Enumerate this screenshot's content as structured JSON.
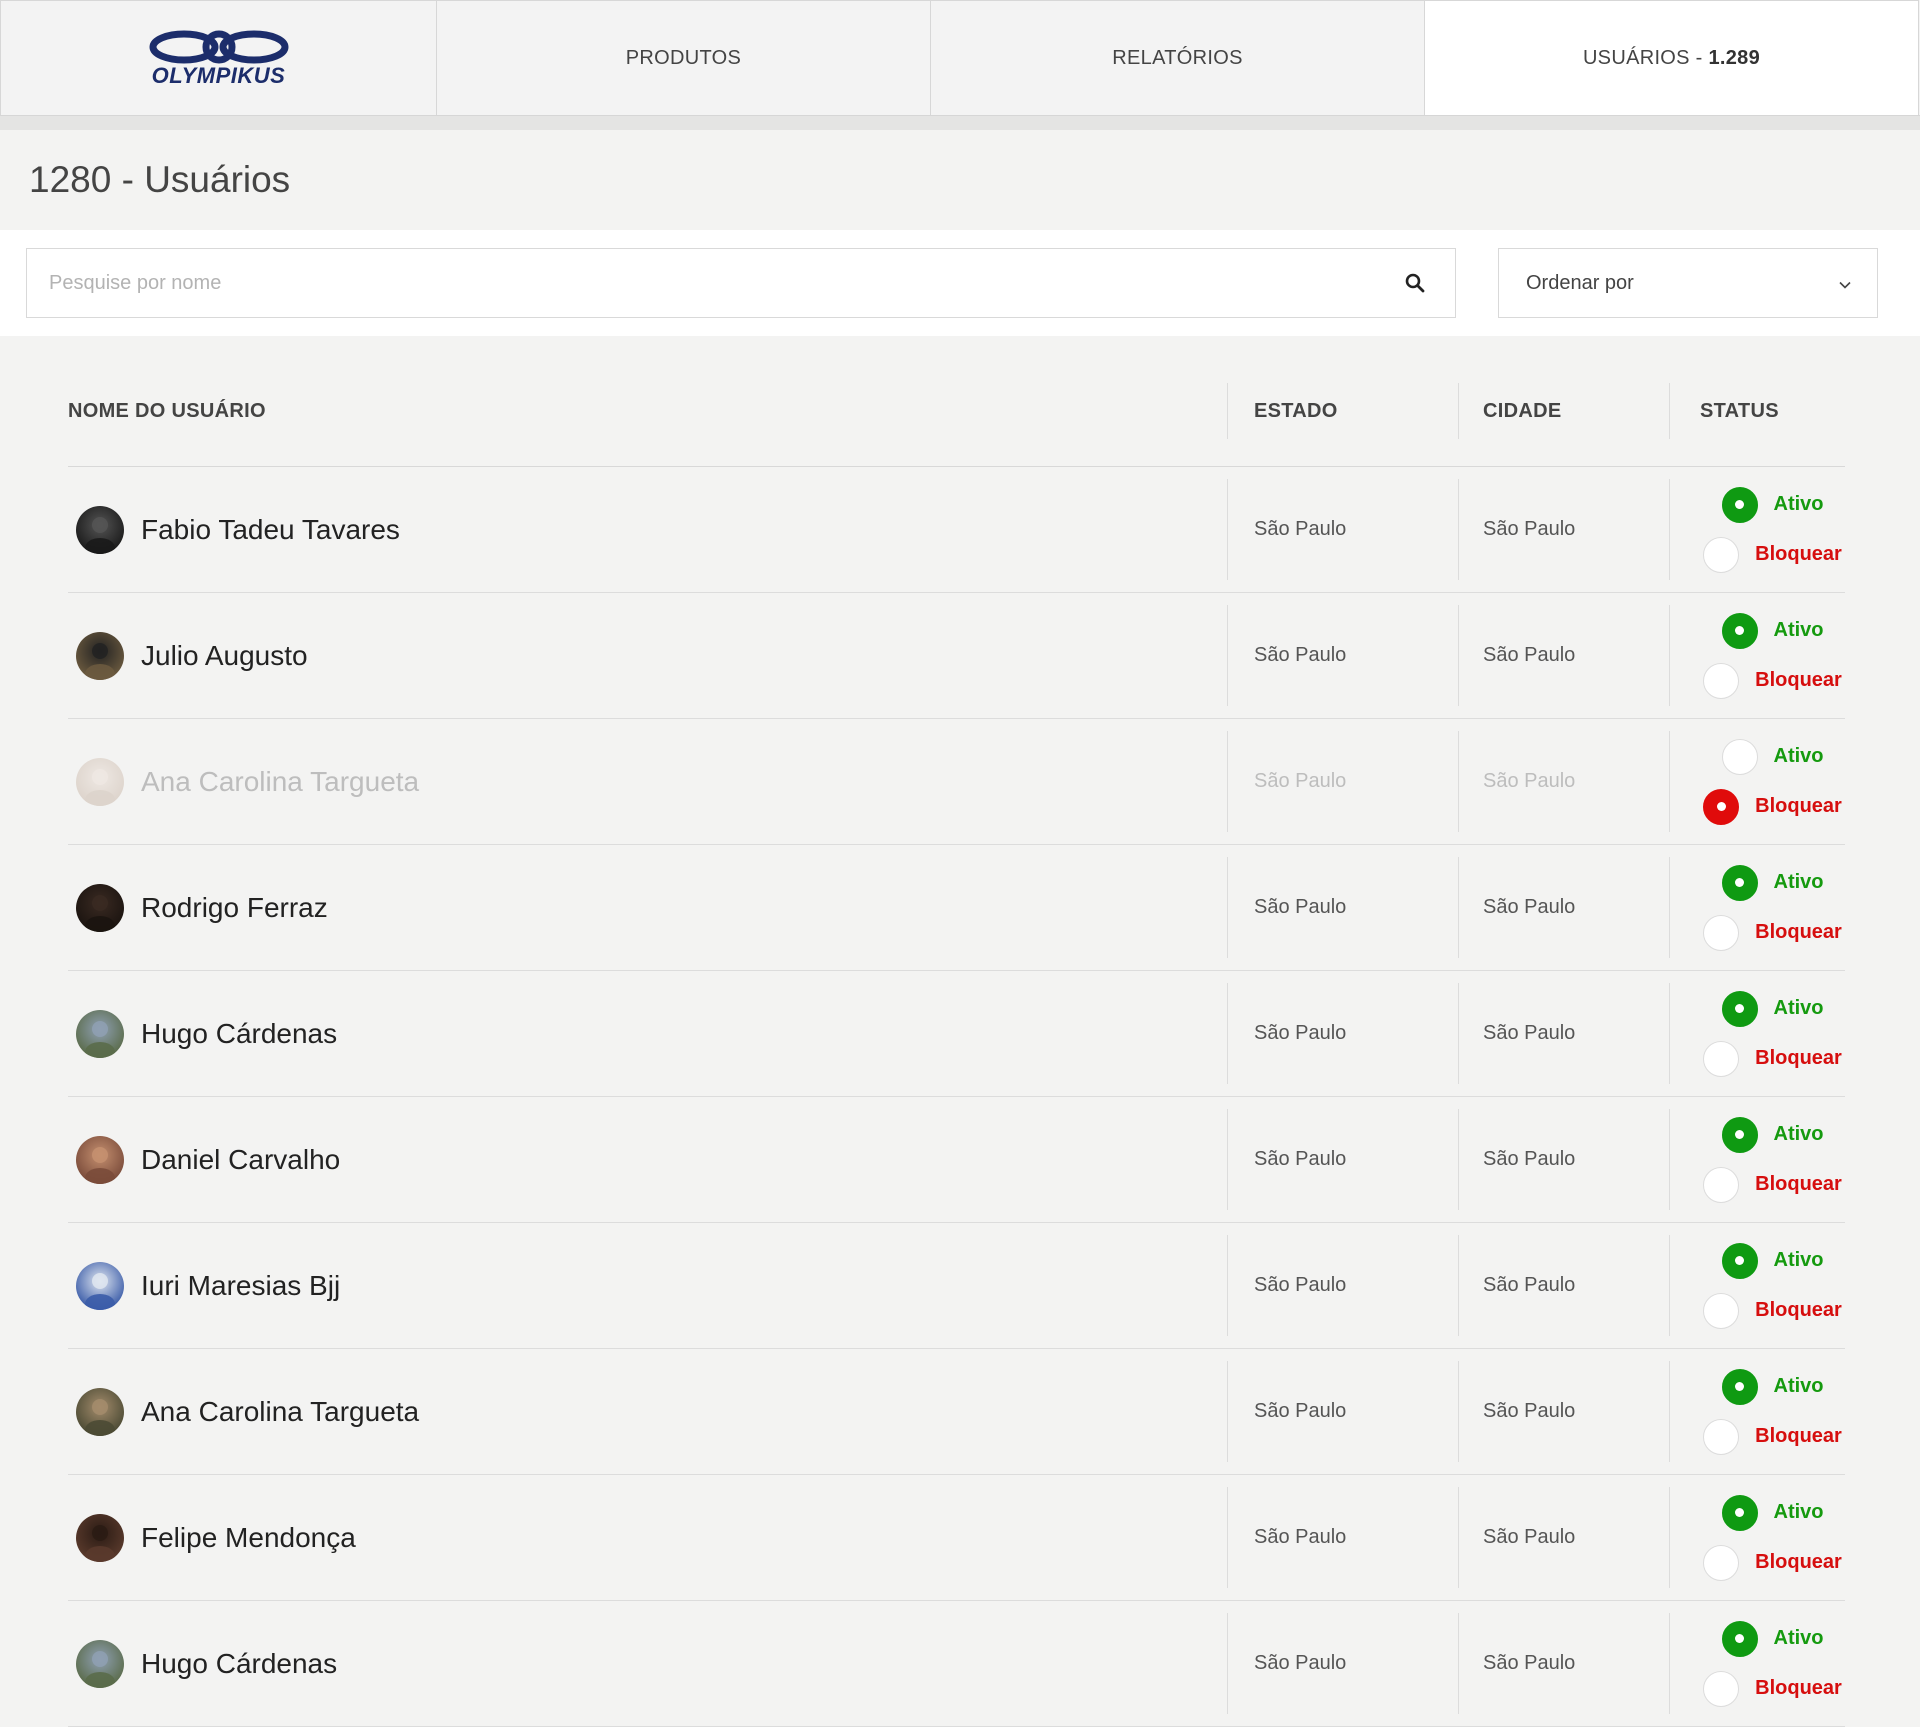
{
  "colors": {
    "active_green": "#0f9a12",
    "block_red": "#e00b0b",
    "brand_navy": "#1c2d6b"
  },
  "nav": {
    "logo_text": "OLYMPIKUS",
    "tabs": [
      {
        "label": "PRODUTOS",
        "count": ""
      },
      {
        "label": "RELATÓRIOS",
        "count": ""
      },
      {
        "label": "USUÁRIOS - ",
        "count": "1.289",
        "active": true
      }
    ]
  },
  "page": {
    "title": "1280 - Usuários"
  },
  "search": {
    "placeholder": "Pesquise por nome",
    "value": "",
    "icon": "search-icon"
  },
  "sort": {
    "label": "Ordenar por",
    "icon": "chevron-down-icon"
  },
  "table": {
    "headers": {
      "name": "NOME DO USUÁRIO",
      "state": "ESTADO",
      "city": "CIDADE",
      "status": "STATUS"
    },
    "status_labels": {
      "active": "Ativo",
      "block": "Bloquear"
    },
    "rows": [
      {
        "name": "Fabio Tadeu Tavares",
        "state": "São Paulo",
        "city": "São Paulo",
        "status": "active"
      },
      {
        "name": "Julio Augusto",
        "state": "São Paulo",
        "city": "São Paulo",
        "status": "active"
      },
      {
        "name": "Ana Carolina Targueta",
        "state": "São Paulo",
        "city": "São Paulo",
        "status": "blocked"
      },
      {
        "name": "Rodrigo Ferraz",
        "state": "São Paulo",
        "city": "São Paulo",
        "status": "active"
      },
      {
        "name": "Hugo Cárdenas",
        "state": "São Paulo",
        "city": "São Paulo",
        "status": "active"
      },
      {
        "name": "Daniel Carvalho",
        "state": "São Paulo",
        "city": "São Paulo",
        "status": "active"
      },
      {
        "name": "Iuri Maresias Bjj",
        "state": "São Paulo",
        "city": "São Paulo",
        "status": "active"
      },
      {
        "name": "Ana Carolina Targueta",
        "state": "São Paulo",
        "city": "São Paulo",
        "status": "active"
      },
      {
        "name": "Felipe Mendonça",
        "state": "São Paulo",
        "city": "São Paulo",
        "status": "active"
      },
      {
        "name": "Hugo Cárdenas",
        "state": "São Paulo",
        "city": "São Paulo",
        "status": "active"
      }
    ]
  }
}
